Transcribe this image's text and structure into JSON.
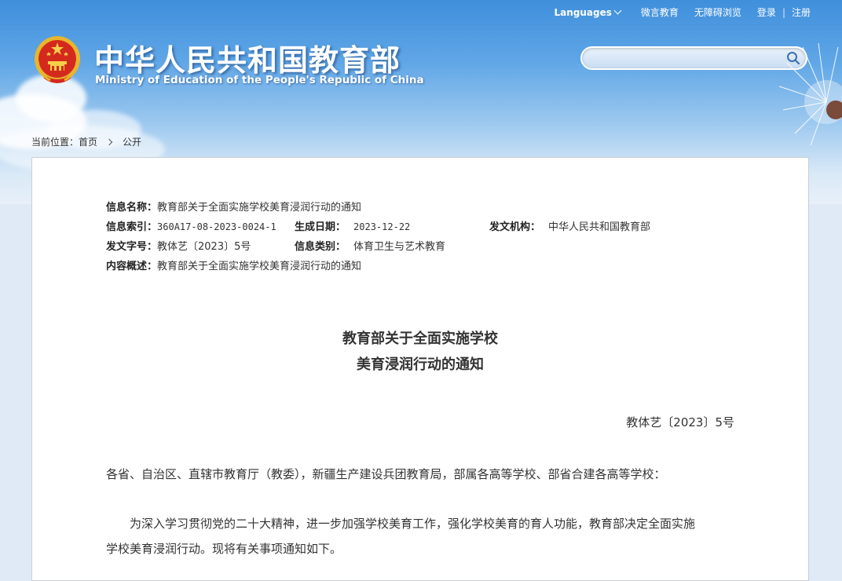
{
  "topbar": {
    "languages": "Languages",
    "links": [
      "微言教育",
      "无障碍浏览",
      "登录",
      "注册"
    ]
  },
  "header": {
    "title": "中华人民共和国教育部",
    "subtitle": "Ministry of Education of the People's Republic of China",
    "search_placeholder": ""
  },
  "breadcrumb": {
    "prefix": "当前位置：",
    "home": "首页",
    "current": "公开"
  },
  "meta": {
    "name_label": "信息名称：",
    "name_value": "教育部关于全面实施学校美育浸润行动的通知",
    "index_label": "信息索引：",
    "index_value": "360A17-08-2023-0024-1",
    "date_label": "生成日期：",
    "date_value": "2023-12-22",
    "org_label": "发文机构：",
    "org_value": "中华人民共和国教育部",
    "docno_label": "发文字号：",
    "docno_value": "教体艺〔2023〕5号",
    "category_label": "信息类别：",
    "category_value": "体育卫生与艺术教育",
    "summary_label": "内容概述：",
    "summary_value": "教育部关于全面实施学校美育浸润行动的通知"
  },
  "document": {
    "title_line1": "教育部关于全面实施学校",
    "title_line2": "美育浸润行动的通知",
    "number": "教体艺〔2023〕5号",
    "recipients": "各省、自治区、直辖市教育厅（教委），新疆生产建设兵团教育局，部属各高等学校、部省合建各高等学校：",
    "para1_line1": "为深入学习贯彻党的二十大精神，进一步加强学校美育工作，强化学校美育的育人功能，教育部决定全面实施",
    "para1_line2": "学校美育浸润行动。现将有关事项通知如下。"
  }
}
